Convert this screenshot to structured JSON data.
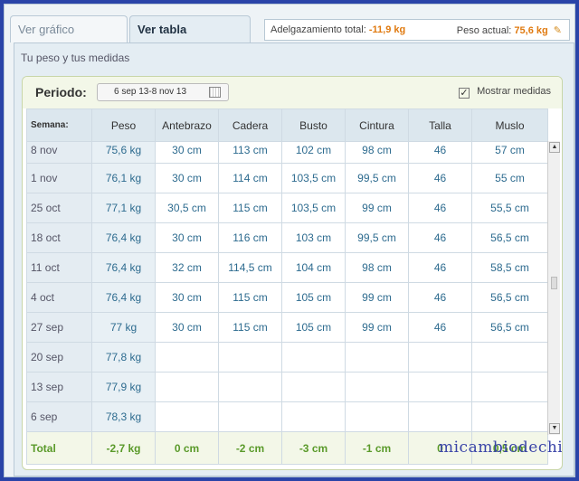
{
  "tabs": {
    "graph": "Ver gráfico",
    "table": "Ver tabla"
  },
  "summary": {
    "loss_label": "Adelgazamiento total:",
    "loss_value": "-11,9 kg",
    "weight_label": "Peso actual:",
    "weight_value": "75,6 kg"
  },
  "panel_title": "Tu peso y tus medidas",
  "period": {
    "label": "Periodo:",
    "value": "6 sep 13-8 nov 13",
    "show_measures": "Mostrar medidas",
    "checked": true
  },
  "table": {
    "headers": [
      "Semana:",
      "Peso",
      "Antebrazo",
      "Cadera",
      "Busto",
      "Cintura",
      "Talla",
      "Muslo"
    ],
    "rows": [
      [
        "8 nov",
        "75,6 kg",
        "30 cm",
        "113 cm",
        "102 cm",
        "98 cm",
        "46",
        "57 cm"
      ],
      [
        "1 nov",
        "76,1 kg",
        "30 cm",
        "114 cm",
        "103,5 cm",
        "99,5 cm",
        "46",
        "55 cm"
      ],
      [
        "25 oct",
        "77,1 kg",
        "30,5 cm",
        "115 cm",
        "103,5 cm",
        "99 cm",
        "46",
        "55,5 cm"
      ],
      [
        "18 oct",
        "76,4 kg",
        "30 cm",
        "116 cm",
        "103 cm",
        "99,5 cm",
        "46",
        "56,5 cm"
      ],
      [
        "11 oct",
        "76,4 kg",
        "32 cm",
        "114,5 cm",
        "104 cm",
        "98 cm",
        "46",
        "58,5 cm"
      ],
      [
        "4 oct",
        "76,4 kg",
        "30 cm",
        "115 cm",
        "105 cm",
        "99 cm",
        "46",
        "56,5 cm"
      ],
      [
        "27 sep",
        "77 kg",
        "30 cm",
        "115 cm",
        "105 cm",
        "99 cm",
        "46",
        "56,5 cm"
      ],
      [
        "20 sep",
        "77,8 kg",
        "",
        "",
        "",
        "",
        "",
        ""
      ],
      [
        "13 sep",
        "77,9 kg",
        "",
        "",
        "",
        "",
        "",
        ""
      ],
      [
        "6 sep",
        "78,3 kg",
        "",
        "",
        "",
        "",
        "",
        ""
      ]
    ],
    "total": [
      "Total",
      "-2,7 kg",
      "0 cm",
      "-2 cm",
      "-3 cm",
      "-1 cm",
      "0",
      "0,5 cm"
    ]
  },
  "watermark": "micambiodechip"
}
